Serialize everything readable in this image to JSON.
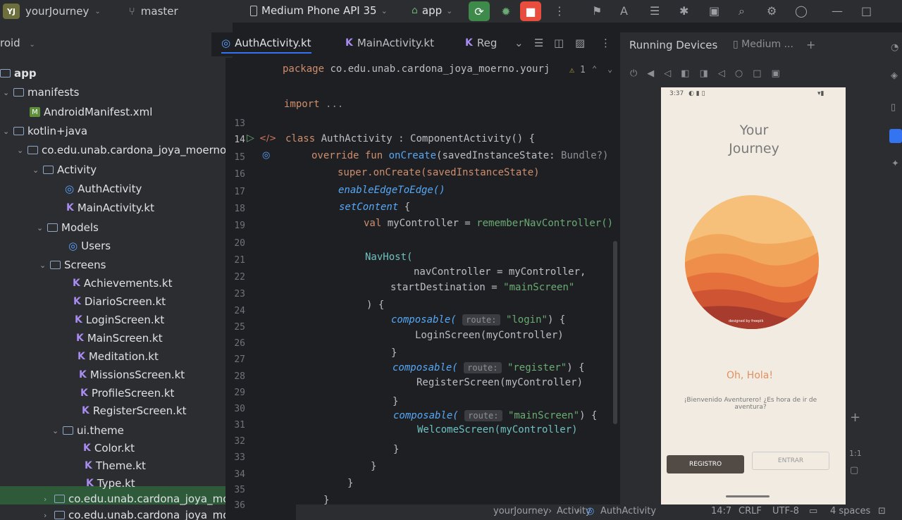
{
  "toolbar": {
    "project_badge": "YJ",
    "project_name": "yourJourney",
    "branch": "master",
    "device": "Medium Phone API 35",
    "run_config": "app"
  },
  "sidebar": {
    "header": "roid",
    "items": [
      {
        "label": "app"
      },
      {
        "label": "manifests"
      },
      {
        "label": "AndroidManifest.xml"
      },
      {
        "label": "kotlin+java"
      },
      {
        "label": "co.edu.unab.cardona_joya_moerno"
      },
      {
        "label": "Activity"
      },
      {
        "label": "AuthActivity"
      },
      {
        "label": "MainActivity.kt"
      },
      {
        "label": "Models"
      },
      {
        "label": "Users"
      },
      {
        "label": "Screens"
      },
      {
        "label": "Achievements.kt"
      },
      {
        "label": "DiarioScreen.kt"
      },
      {
        "label": "LoginScreen.kt"
      },
      {
        "label": "MainScreen.kt"
      },
      {
        "label": "Meditation.kt"
      },
      {
        "label": "MissionsScreen.kt"
      },
      {
        "label": "ProfileScreen.kt"
      },
      {
        "label": "RegisterScreen.kt"
      },
      {
        "label": "ui.theme"
      },
      {
        "label": "Color.kt"
      },
      {
        "label": "Theme.kt"
      },
      {
        "label": "Type.kt"
      },
      {
        "label": "co.edu.unab.cardona_joya_moerno"
      },
      {
        "label": "co.edu.unab.cardona_joya_moerno"
      }
    ]
  },
  "editor": {
    "tabs": [
      "AuthActivity.kt",
      "MainActivity.kt",
      "Reg"
    ],
    "line_numbers": [
      "13",
      "14",
      "15",
      "16",
      "17",
      "18",
      "19",
      "20",
      "21",
      "22",
      "23",
      "24",
      "25",
      "26",
      "27",
      "28",
      "29",
      "30",
      "31",
      "32",
      "33",
      "34",
      "35",
      "36"
    ],
    "warning_count": "1",
    "code": {
      "package_kw": "package",
      "package_name": "co.edu.unab.cardona_joya_moerno.yourj",
      "import_kw": "import",
      "import_dots": "...",
      "l14_a": "class",
      "l14_b": "AuthActivity : ComponentActivity() {",
      "l15_a": "override fun",
      "l15_b": "onCreate",
      "l15_c": "(savedInstanceState:",
      "l15_d": "Bundle?)",
      "l16": "super.onCreate(savedInstanceState)",
      "l17": "enableEdgeToEdge()",
      "l18_a": "setContent",
      "l18_b": "{",
      "l19_a": "val",
      "l19_b": "myController =",
      "l19_c": "rememberNavController()",
      "l21": "NavHost(",
      "l22": "navController = myController,",
      "l23_a": "startDestination =",
      "l23_b": "\"mainScreen\"",
      "l24": ") {",
      "l25_a": "composable(",
      "l25_h": "route:",
      "l25_b": "\"login\"",
      "l25_c": ") {",
      "l26": "LoginScreen(myController)",
      "l27": "}",
      "l28_a": "composable(",
      "l28_h": "route:",
      "l28_b": "\"register\"",
      "l28_c": ") {",
      "l29": "RegisterScreen(myController)",
      "l30": "}",
      "l31_a": "composable(",
      "l31_h": "route:",
      "l31_b": "\"mainScreen\"",
      "l31_c": ") {",
      "l32": "WelcomeScreen(myController)",
      "l33": "}",
      "l34": "}",
      "l35": "}",
      "l36": "}"
    }
  },
  "running_devices": {
    "header": "Running Devices",
    "tab": "Medium ...",
    "phone": {
      "status_time": "3:37",
      "title_line1": "Your",
      "title_line2": "Journey",
      "art_credit": "designed by freepik",
      "greeting": "Oh, Hola!",
      "welcome_line1": "¡Bienvenido Aventurero! ¿Es hora de ir de",
      "welcome_line2": "aventura?",
      "register_button": "REGISTRO",
      "enter_button": "ENTRAR"
    }
  },
  "statusbar": {
    "breadcrumb_1": "yourJourney",
    "breadcrumb_2": "Activity",
    "breadcrumb_3": "AuthActivity",
    "position": "14:7",
    "line_sep": "CRLF",
    "encoding": "UTF-8",
    "indent": "4 spaces"
  },
  "colors": {
    "run_button": "#3e8a4a",
    "stop_button": "#e84d3d",
    "accent_greeting": "#e09060"
  }
}
